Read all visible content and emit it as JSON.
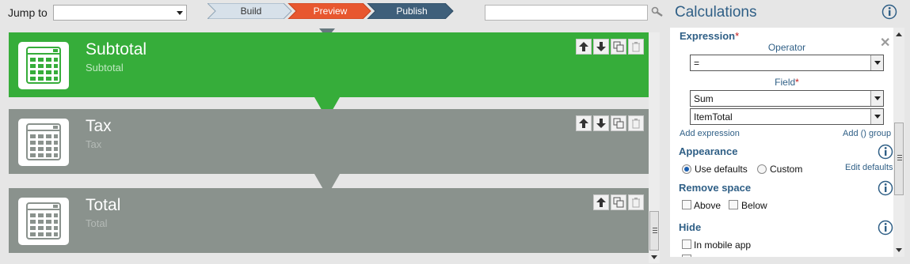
{
  "topbar": {
    "jump_label": "Jump to",
    "jump_value": "",
    "search_value": ""
  },
  "steps": [
    {
      "label": "Build",
      "state": "done",
      "color": "#d7e1ea"
    },
    {
      "label": "Preview",
      "state": "active",
      "color": "#e8572f"
    },
    {
      "label": "Publish",
      "state": "upcoming",
      "color": "#3e5f7a"
    }
  ],
  "cards": [
    {
      "title": "Subtotal",
      "subtitle": "Subtotal",
      "selected": true
    },
    {
      "title": "Tax",
      "subtitle": "Tax",
      "selected": false
    },
    {
      "title": "Total",
      "subtitle": "Total",
      "selected": false
    }
  ],
  "panel": {
    "title": "Calculations",
    "expression_label": "Expression",
    "required_mark": "*",
    "operator_label": "Operator",
    "operator_value": "=",
    "field_label": "Field",
    "field_value_1": "Sum",
    "field_value_2": "ItemTotal",
    "add_expression": "Add expression",
    "add_group": "Add () group",
    "appearance_label": "Appearance",
    "use_defaults": "Use defaults",
    "custom": "Custom",
    "edit_defaults": "Edit defaults",
    "remove_space_label": "Remove space",
    "above": "Above",
    "below": "Below",
    "hide_label": "Hide",
    "in_mobile_app": "In mobile app"
  },
  "colors": {
    "selected_card": "#36ad3a",
    "card": "#8a928d",
    "accent": "#2f5f86"
  }
}
